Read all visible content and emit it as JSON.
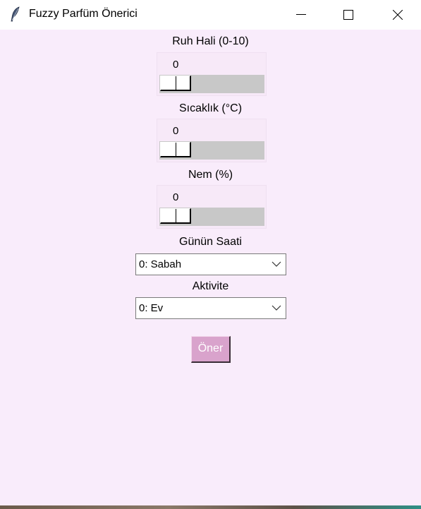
{
  "window": {
    "title": "Fuzzy Parfüm Önerici",
    "icon": "feather-icon"
  },
  "form": {
    "mood": {
      "label": "Ruh Hali (0-10)",
      "value": "0"
    },
    "temperature": {
      "label": "Sıcaklık (°C)",
      "value": "0"
    },
    "humidity": {
      "label": "Nem (%)",
      "value": "0"
    },
    "time_of_day": {
      "label": "Günün Saati",
      "selected": "0: Sabah"
    },
    "activity": {
      "label": "Aktivite",
      "selected": "0: Ev"
    },
    "submit_label": "Öner"
  },
  "colors": {
    "background": "#f9ecfb",
    "button": "#d9a3cc",
    "trough": "#c8c8c8"
  }
}
